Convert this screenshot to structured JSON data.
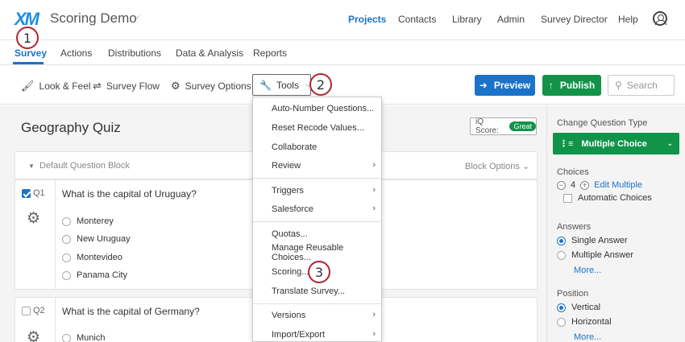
{
  "app": {
    "logo": "XM",
    "project_title": "Scoring Demo"
  },
  "topnav": {
    "links": [
      "Projects",
      "Contacts",
      "Library",
      "Admin",
      "Survey Director",
      "Help"
    ],
    "active": "Projects"
  },
  "subtabs": {
    "items": [
      "Survey",
      "Actions",
      "Distributions",
      "Data & Analysis",
      "Reports"
    ],
    "active": "Survey"
  },
  "toolbar": {
    "look_feel": "Look & Feel",
    "survey_flow": "Survey Flow",
    "survey_options": "Survey Options",
    "tools": "Tools",
    "preview": "Preview",
    "publish": "Publish",
    "search_placeholder": "Search"
  },
  "survey": {
    "title": "Geography Quiz",
    "iq_score_label": "iQ Score:",
    "iq_score_value": "Great",
    "block_title": "Default Question Block",
    "block_options": "Block Options"
  },
  "questions": [
    {
      "num": "Q1",
      "text": "What is the capital of Uruguay?",
      "checked": true,
      "choices": [
        "Monterey",
        "New Uruguay",
        "Montevideo",
        "Panama City"
      ]
    },
    {
      "num": "Q2",
      "text": "What is the capital of Germany?",
      "checked": false,
      "choices": [
        "Munich"
      ]
    }
  ],
  "right_panel": {
    "change_type_label": "Change Question Type",
    "question_type": "Multiple Choice",
    "choices_label": "Choices",
    "choices_count": "4",
    "edit_multiple": "Edit Multiple",
    "automatic_choices": "Automatic Choices",
    "answers_label": "Answers",
    "single_answer": "Single Answer",
    "multiple_answer": "Multiple Answer",
    "more": "More...",
    "position_label": "Position",
    "vertical": "Vertical",
    "horizontal": "Horizontal"
  },
  "tools_menu": {
    "items": [
      {
        "label": "Auto-Number Questions...",
        "submenu": false
      },
      {
        "label": "Reset Recode Values...",
        "submenu": false
      },
      {
        "label": "Collaborate",
        "submenu": false
      },
      {
        "label": "Review",
        "submenu": true
      },
      {
        "label": "Triggers",
        "submenu": true
      },
      {
        "label": "Salesforce",
        "submenu": true
      },
      {
        "label": "Quotas...",
        "submenu": false
      },
      {
        "label": "Manage Reusable Choices...",
        "submenu": false
      },
      {
        "label": "Scoring...",
        "submenu": false
      },
      {
        "label": "Translate Survey...",
        "submenu": false
      },
      {
        "label": "Versions",
        "submenu": true
      },
      {
        "label": "Import/Export",
        "submenu": true
      }
    ]
  },
  "callouts": [
    "1",
    "2",
    "3"
  ],
  "colors": {
    "accent_blue": "#1a73c8",
    "publish_green": "#12934a",
    "callout_red": "#b1262e"
  }
}
